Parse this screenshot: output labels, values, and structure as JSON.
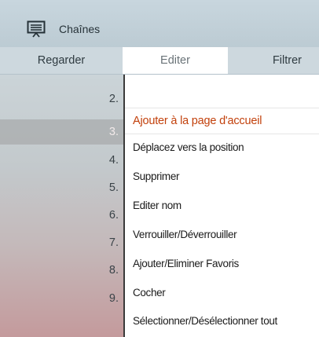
{
  "header": {
    "title": "Chaînes",
    "icon": "tv-channels-icon"
  },
  "tabs": [
    {
      "label": "Regarder",
      "active": false
    },
    {
      "label": "Editer",
      "active": true
    },
    {
      "label": "Filtrer",
      "active": false
    }
  ],
  "channel_list": {
    "items": [
      {
        "number": "2.",
        "selected": false
      },
      {
        "number": "3.",
        "selected": true
      },
      {
        "number": "4.",
        "selected": false
      },
      {
        "number": "5.",
        "selected": false
      },
      {
        "number": "6.",
        "selected": false
      },
      {
        "number": "7.",
        "selected": false
      },
      {
        "number": "8.",
        "selected": false
      },
      {
        "number": "9.",
        "selected": false
      }
    ]
  },
  "edit_menu": {
    "items": [
      {
        "label": "Ajouter à la page d'accueil",
        "highlighted": true
      },
      {
        "label": "Déplacez vers la position",
        "highlighted": false
      },
      {
        "label": "Supprimer",
        "highlighted": false
      },
      {
        "label": "Editer nom",
        "highlighted": false
      },
      {
        "label": "Verrouiller/Déverrouiller",
        "highlighted": false
      },
      {
        "label": "Ajouter/Eliminer Favoris",
        "highlighted": false
      },
      {
        "label": "Cocher",
        "highlighted": false
      },
      {
        "label": "Sélectionner/Désélectionner tout",
        "highlighted": false
      }
    ]
  },
  "colors": {
    "accent_text": "#c2410c",
    "header_bg": "#c8d6de",
    "divider": "#3a3a3a"
  }
}
